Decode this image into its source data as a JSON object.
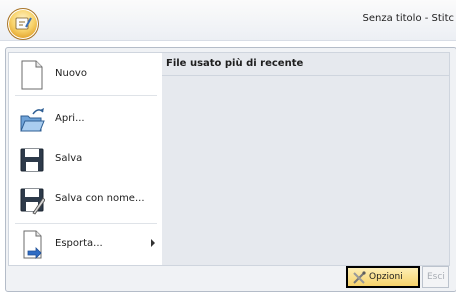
{
  "window": {
    "title": "Senza titolo - Stitc"
  },
  "menu": {
    "items": [
      {
        "label": "Nuovo",
        "icon": "new-document-icon"
      },
      {
        "label": "Apri...",
        "icon": "open-folder-icon"
      },
      {
        "label": "Salva",
        "icon": "floppy-disk-icon"
      },
      {
        "label": "Salva con nome...",
        "icon": "save-as-icon"
      },
      {
        "label": "Esporta...",
        "icon": "export-icon",
        "has_submenu": true
      }
    ]
  },
  "recent": {
    "title": "File usato più di recente"
  },
  "footer": {
    "options_label": "Opzioni",
    "exit_label": "Esci"
  },
  "colors": {
    "highlight": "#f7d36b",
    "pane_bg": "#e6e9ee"
  }
}
